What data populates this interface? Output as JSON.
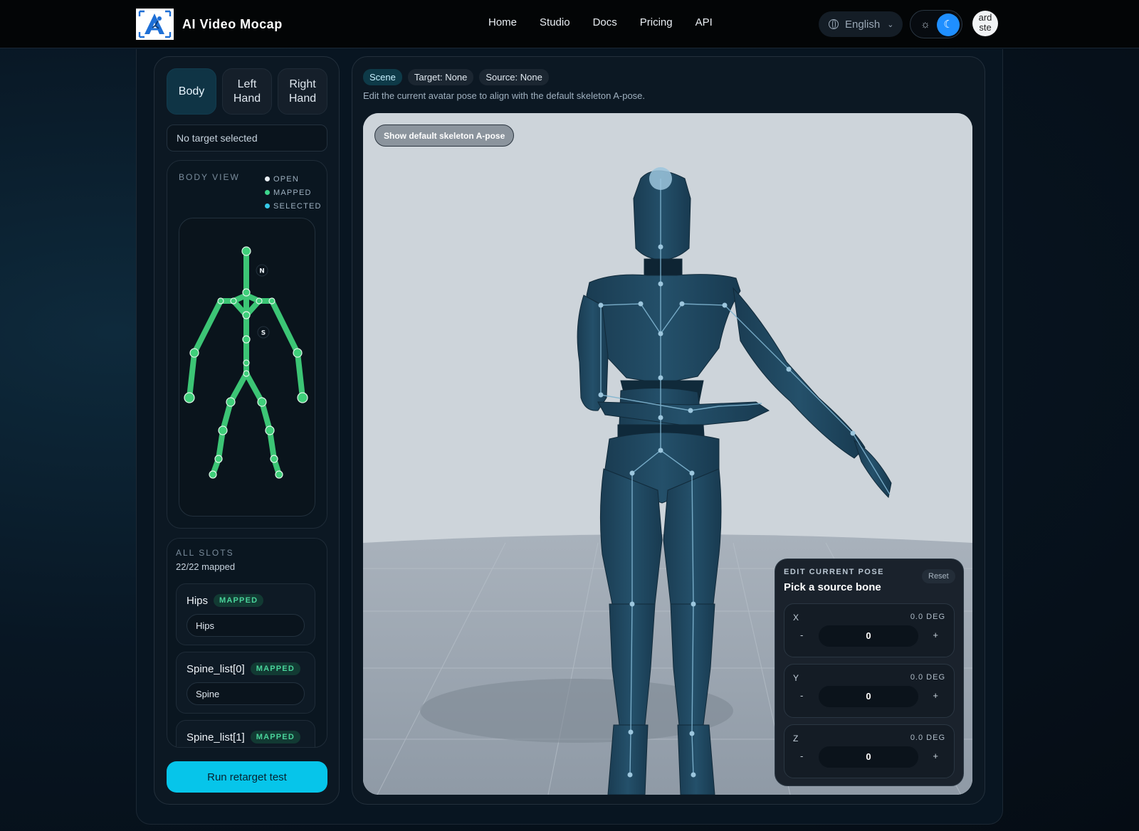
{
  "brand": {
    "name": "AI Video Mocap"
  },
  "nav": {
    "links": [
      "Home",
      "Studio",
      "Docs",
      "Pricing",
      "API"
    ]
  },
  "language": {
    "label": "English"
  },
  "user": {
    "initials_top": "ard",
    "initials_bottom": "ste"
  },
  "sidebar": {
    "tabs": [
      {
        "label": "Body",
        "active": true
      },
      {
        "label": "Left Hand",
        "active": false
      },
      {
        "label": "Right Hand",
        "active": false
      }
    ],
    "target_status": "No target selected",
    "body_view": {
      "title": "BODY VIEW",
      "legend": [
        {
          "label": "OPEN",
          "color": "#e8eef3"
        },
        {
          "label": "MAPPED",
          "color": "#3dd68c"
        },
        {
          "label": "SELECTED",
          "color": "#35c9e8"
        }
      ],
      "markers": {
        "neck": "N",
        "spine": "S"
      }
    },
    "slots": {
      "title": "ALL SLOTS",
      "count": "22/22 mapped",
      "items": [
        {
          "name": "Hips",
          "status": "MAPPED",
          "value": "Hips"
        },
        {
          "name": "Spine_list[0]",
          "status": "MAPPED",
          "value": "Spine"
        },
        {
          "name": "Spine_list[1]",
          "status": "MAPPED",
          "value": ""
        }
      ]
    },
    "run_button": "Run retarget test"
  },
  "main": {
    "chips": [
      {
        "label": "Scene",
        "active": true
      },
      {
        "label": "Target: None",
        "active": false
      },
      {
        "label": "Source: None",
        "active": false
      }
    ],
    "description": "Edit the current avatar pose to align with the default skeleton A-pose.",
    "show_button": "Show default skeleton A-pose",
    "pose_panel": {
      "label": "EDIT CURRENT POSE",
      "title": "Pick a source bone",
      "reset": "Reset",
      "axes": [
        {
          "name": "X",
          "deg": "0.0 DEG",
          "value": "0",
          "minus": "-",
          "plus": "+"
        },
        {
          "name": "Y",
          "deg": "0.0 DEG",
          "value": "0",
          "minus": "-",
          "plus": "+"
        },
        {
          "name": "Z",
          "deg": "0.0 DEG",
          "value": "0",
          "minus": "-",
          "plus": "+"
        }
      ]
    }
  },
  "colors": {
    "accent": "#06c5ea",
    "mapped": "#3dd68c",
    "avatar_body": "#214a63",
    "theme_active": "#1f8fff"
  }
}
